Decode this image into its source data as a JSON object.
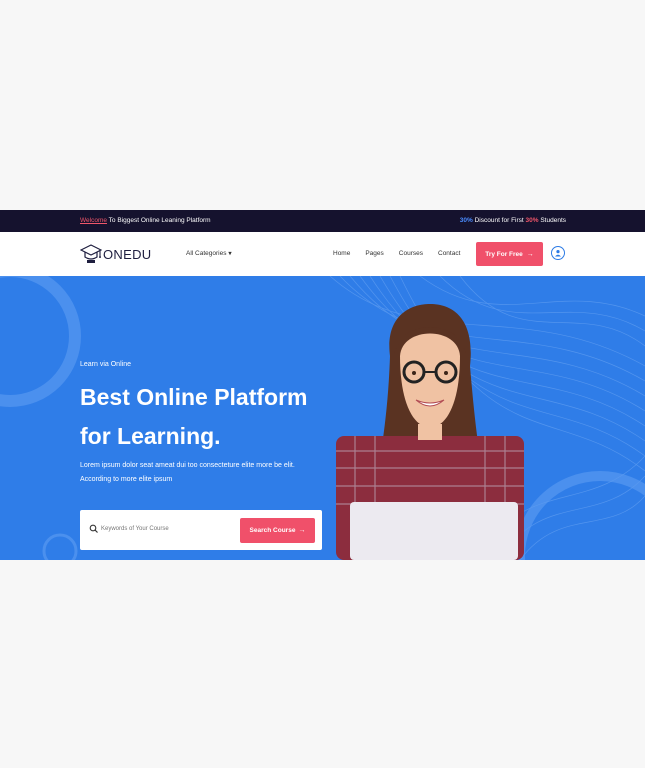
{
  "topbar": {
    "welcome_link": "Welcome",
    "welcome_rest": " To Biggest Online Leaning Platform",
    "discount_pct1": "30%",
    "discount_mid": " Discount for First ",
    "discount_pct2": "30%",
    "discount_end": " Students"
  },
  "nav": {
    "logo_text": "ONEDU",
    "categories_label": "All Categories",
    "menu": [
      "Home",
      "Pages",
      "Courses",
      "Contact"
    ],
    "cta_label": "Try For Free"
  },
  "hero": {
    "eyebrow": "Learn via Online",
    "title_line1": "Best Online Platform",
    "title_line2": "for Learning.",
    "description_line1": "Lorem ipsum dolor seat ameat dui too consecteture elite more be elit.",
    "description_line2": "According to more elite ipsum",
    "search_placeholder": "Keywords of Your Course",
    "search_button": "Search Course"
  },
  "colors": {
    "topbar_bg": "#15122e",
    "hero_bg": "#2f7de8",
    "accent_red": "#f0506a",
    "accent_blue": "#4a8cff"
  },
  "icons": [
    "graduation-cap-logo-icon",
    "chevron-down-icon",
    "arrow-right-icon",
    "user-icon",
    "search-icon"
  ]
}
